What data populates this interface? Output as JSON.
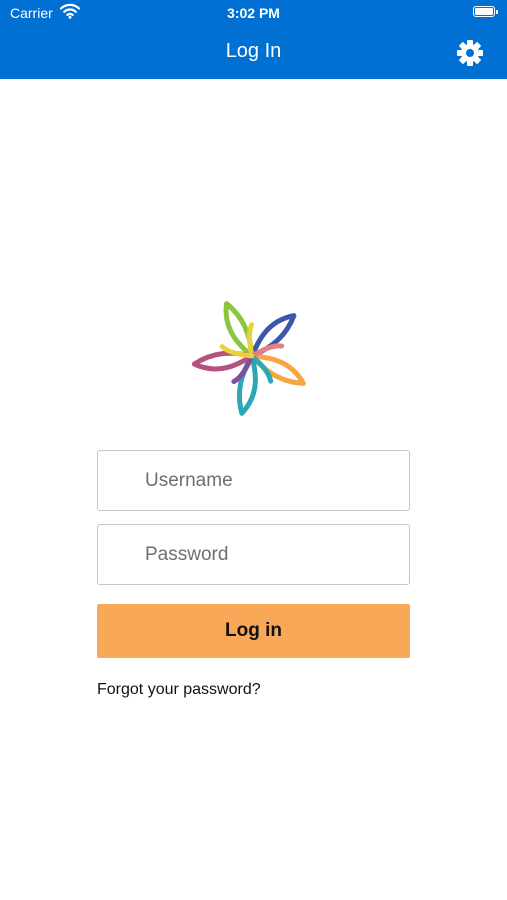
{
  "status_bar": {
    "carrier": "Carrier",
    "time": "3:02 PM"
  },
  "header": {
    "title": "Log In",
    "settings_icon": "gear-icon",
    "background_color": "#0070d2"
  },
  "login_form": {
    "username_placeholder": "Username",
    "password_placeholder": "Password",
    "login_label": "Log in",
    "login_button_color": "#f9a857",
    "forgot_password_label": "Forgot your password?"
  },
  "logo": {
    "icon": "flower-logo-icon"
  }
}
